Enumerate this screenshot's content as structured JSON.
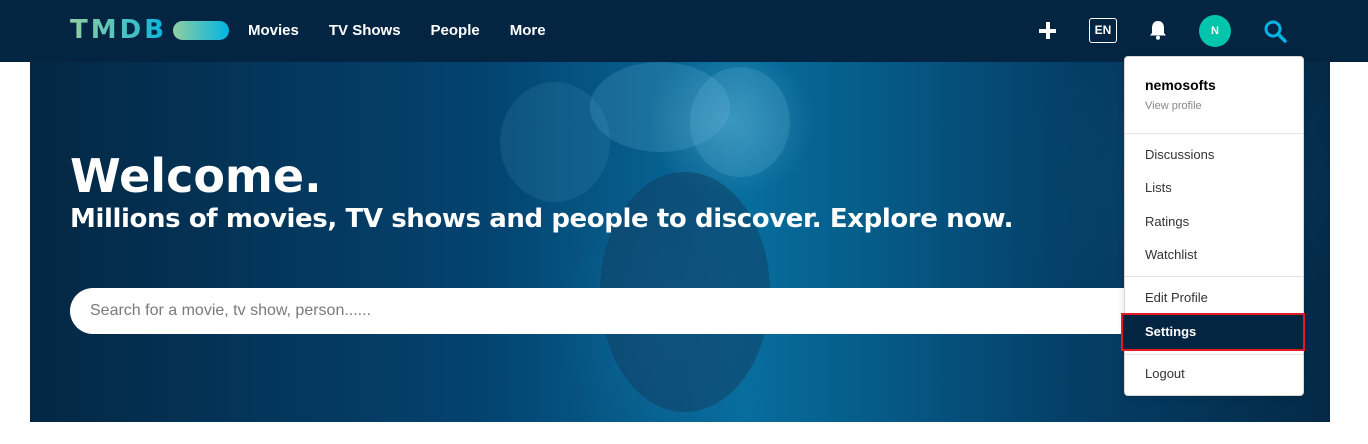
{
  "brand": {
    "logo_text": "TMDB",
    "colors": {
      "navy": "#032541",
      "green": "#90cea1",
      "blue": "#01b4e4",
      "teal_avatar": "#01c6ac",
      "highlight_border": "#e01b24"
    }
  },
  "nav": {
    "items": [
      {
        "label": "Movies"
      },
      {
        "label": "TV Shows"
      },
      {
        "label": "People"
      },
      {
        "label": "More"
      }
    ]
  },
  "toolbar": {
    "add_icon": "plus-icon",
    "language": "EN",
    "notifications_icon": "bell-icon",
    "avatar_initial": "N",
    "search_icon": "search-icon"
  },
  "hero": {
    "title": "Welcome.",
    "subtitle": "Millions of movies, TV shows and people to discover. Explore now.",
    "search_placeholder": "Search for a movie, tv show, person......"
  },
  "user_menu": {
    "username": "nemosofts",
    "view_profile": "View profile",
    "items": [
      {
        "label": "Discussions"
      },
      {
        "label": "Lists"
      },
      {
        "label": "Ratings"
      },
      {
        "label": "Watchlist"
      },
      {
        "label": "Edit Profile"
      },
      {
        "label": "Settings"
      },
      {
        "label": "Logout"
      }
    ]
  }
}
